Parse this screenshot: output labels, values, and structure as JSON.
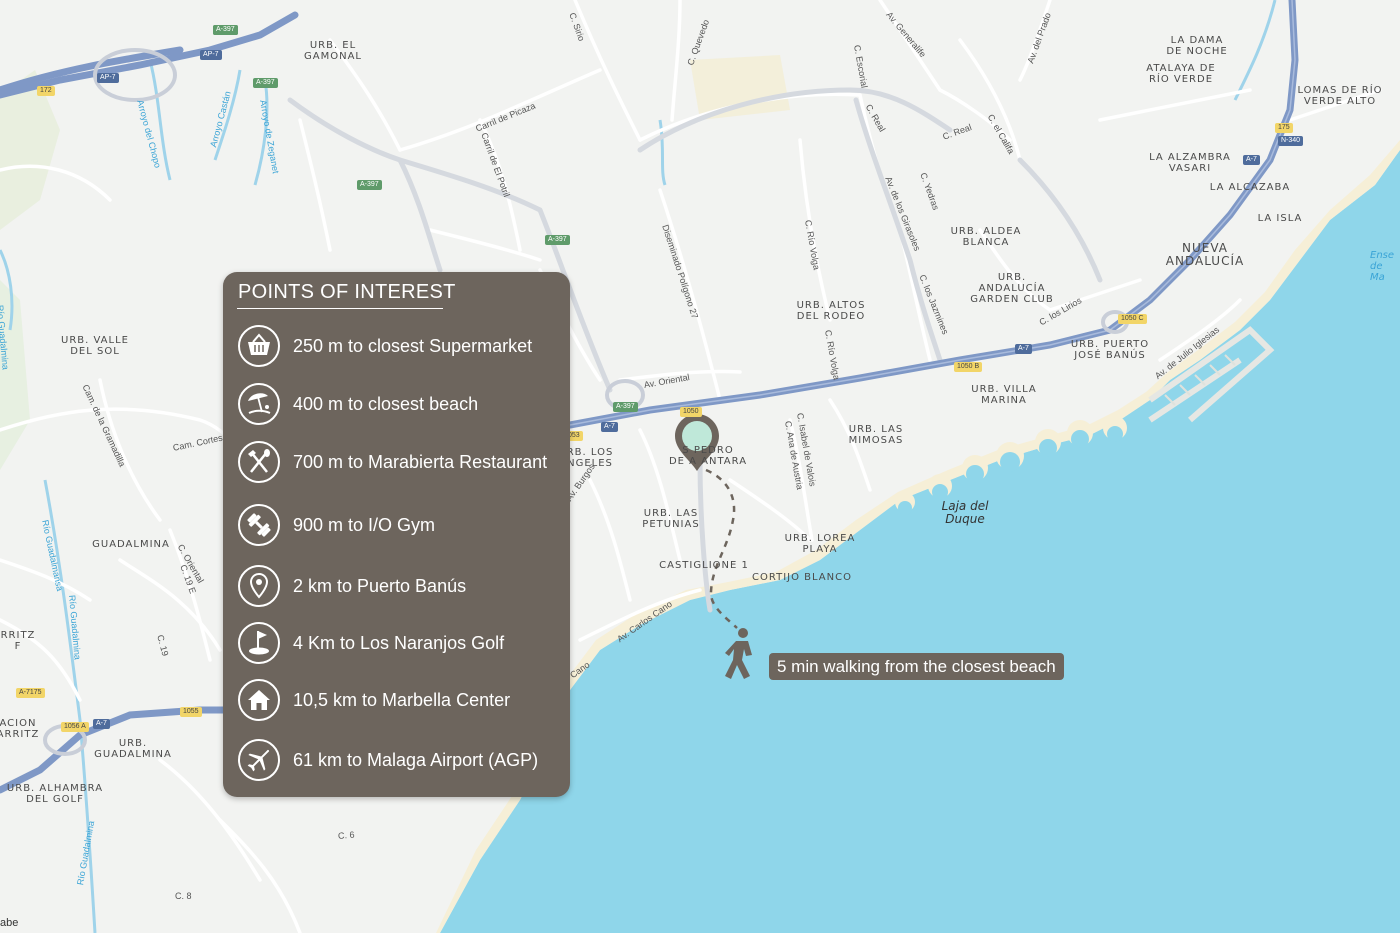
{
  "panel": {
    "title": "POINTS OF INTEREST",
    "items": [
      {
        "icon": "basket-icon",
        "text": "250 m to closest Supermarket"
      },
      {
        "icon": "beach-umbrella-icon",
        "text": "400 m to closest beach"
      },
      {
        "icon": "fork-knife-icon",
        "text": "700 m to  Marabierta Restaurant"
      },
      {
        "icon": "dumbbell-icon",
        "text": "900 m to I/O Gym"
      },
      {
        "icon": "location-pin-icon",
        "text": " 2 km to Puerto Banús"
      },
      {
        "icon": "golf-flag-icon",
        "text": "4 Km to Los Naranjos Golf"
      },
      {
        "icon": "house-icon",
        "text": "10,5 km to Marbella Center"
      },
      {
        "icon": "airplane-icon",
        "text": "61 km to Malaga Airport (AGP)"
      }
    ]
  },
  "walk_label": "5 min walking from the closest beach",
  "colors": {
    "panel": "#6d655d",
    "sea": "#8fd6ea",
    "land": "#f2f3f1",
    "highway": "#7f98c6",
    "beach": "#f6efd7",
    "marker": "#bfe8d9"
  },
  "map": {
    "areas": [
      "URB. EL\nGAMONAL",
      "LA DAMA\nDE NOCHE",
      "ATALAYA DE\nRÍO VERDE",
      "LOMAS DE RÍO\nVERDE ALTO",
      "LA ALZAMBRA\nVASARI",
      "LA ALCAZABA",
      "LA ISLA",
      "NUEVA\nANDALUCÍA",
      "URB. ALDEA\nBLANCA",
      "URB.\nANDALUCÍA\nGARDEN CLUB",
      "URB. PUERTO\nJOSÉ BANÚS",
      "URB. VILLA\nMARINA",
      "URB. ALTOS\nDEL RODEO",
      "URB. LAS\nMIMOSAS",
      "URB. VALLE\nDEL SOL",
      "S  PEDRO\nDE A   ANTARA",
      "RB. LOS\nNGELES",
      "URB. LAS\nPETUNIAS",
      "URB. LOREA\nPLAYA",
      "CASTIGLIONE 1",
      "CORTIJO BLANCO",
      "GUADALMINA",
      "URB.\nGUADALMINA",
      "URB. ALHAMBRA\nDEL GOLF",
      "RRITZ\nF",
      "ACION\nARRITZ"
    ],
    "streets": [
      "C. Sirio",
      "C. Quevedo",
      "Av. Generalife",
      "Av. del Prado",
      "C. Escorial",
      "C. Real",
      "C. Real",
      "C. el Califa",
      "Carril de Picaza",
      "Carril de El Potril",
      "Diseminado Polígono 27",
      "C. Río Volga",
      "C. Río Volga",
      "Av. de los Girasoles",
      "C. Yedras",
      "C. los Jazmines",
      "C. los Lirios",
      "Av. de Julio Iglesias",
      "Av. Oriental",
      "C. Isabel de Valois",
      "C. Ana de Austria",
      "Av. Burgos",
      "Av. Carlos Cano",
      "Cam. Cortes",
      "Cam. de la Gramadilla",
      "C. Oriental",
      "C. 19 E",
      "C. 19",
      "C. 6",
      "C. 8",
      "Arroyo del Chopo",
      "Arroyo Castán",
      "Arroyo de Zeganet",
      "Río Guadalmina",
      "Río Guadalmansa",
      "Río Guadalmina",
      "Río Guadalmina",
      "Cano",
      "ca",
      "abe"
    ],
    "shields": [
      "A-397",
      "AP-7",
      "AP-7",
      "A-397",
      "172",
      "A-397",
      "A-397",
      "A-397",
      "A-7",
      "1050 C",
      "1050 B",
      "A-7",
      "175",
      "N-340",
      "A-7",
      "A-7175",
      "1056 A",
      "A-7",
      "1055",
      "053",
      "A-397",
      "1050"
    ],
    "water_labels": [
      "Laja del\nDuque",
      "Ense\nde Ma"
    ]
  }
}
